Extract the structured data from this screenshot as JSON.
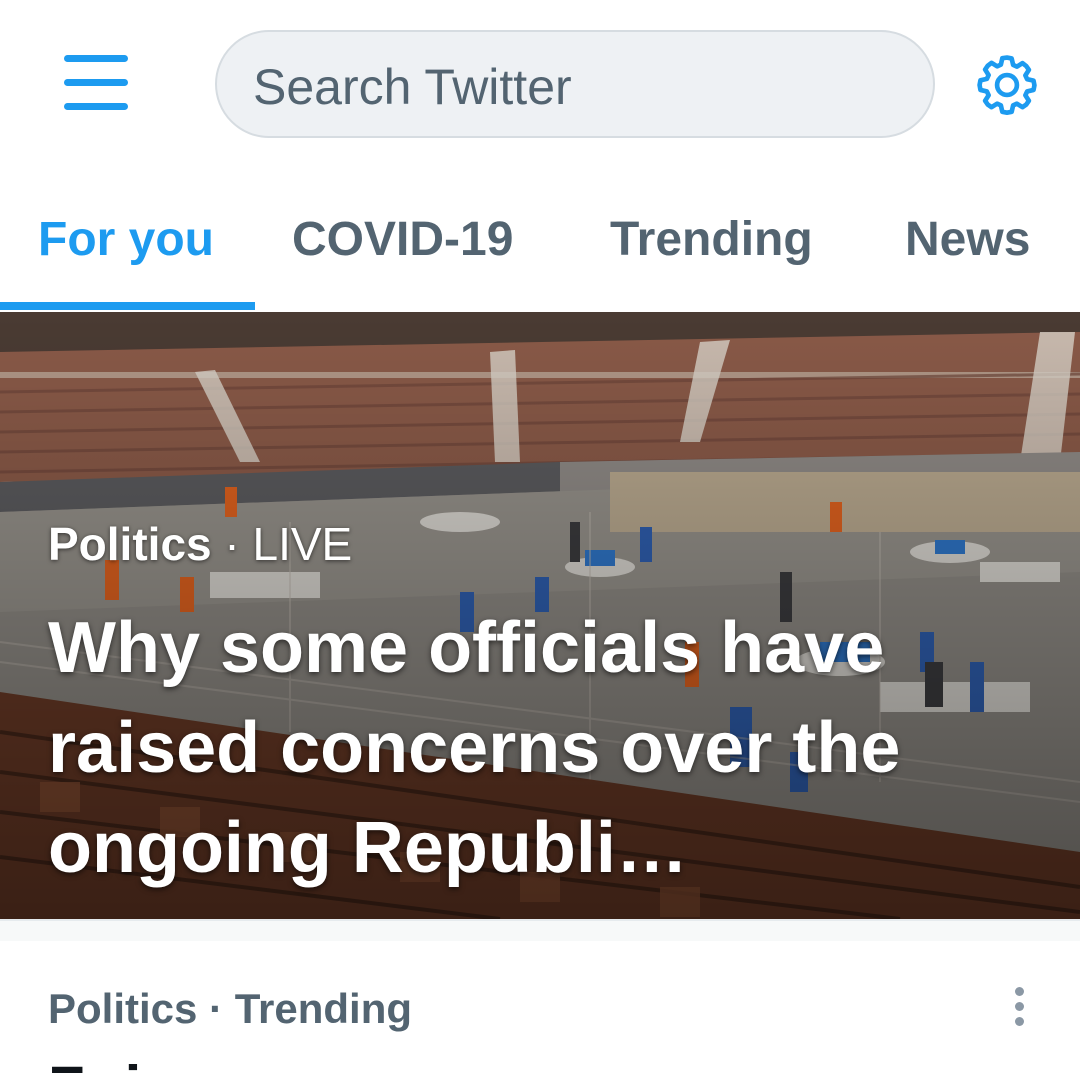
{
  "search": {
    "placeholder": "Search Twitter"
  },
  "icons": {
    "menu": "hamburger-menu-icon",
    "settings": "gear-icon",
    "more": "more-vertical-icon"
  },
  "colors": {
    "accent": "#1d9bf0",
    "secondary_text": "#536471",
    "search_bg": "#eef1f4"
  },
  "tabs": [
    {
      "label": "For you",
      "active": true
    },
    {
      "label": "COVID-19",
      "active": false
    },
    {
      "label": "Trending",
      "active": false
    },
    {
      "label": "News",
      "active": false
    }
  ],
  "hero": {
    "category": "Politics",
    "separator": " · ",
    "status": "LIVE",
    "title": "Why some officials have raised concerns over the ongoing Republi…"
  },
  "trend": {
    "meta": "Politics · Trending",
    "title_partial": "Fr i"
  }
}
